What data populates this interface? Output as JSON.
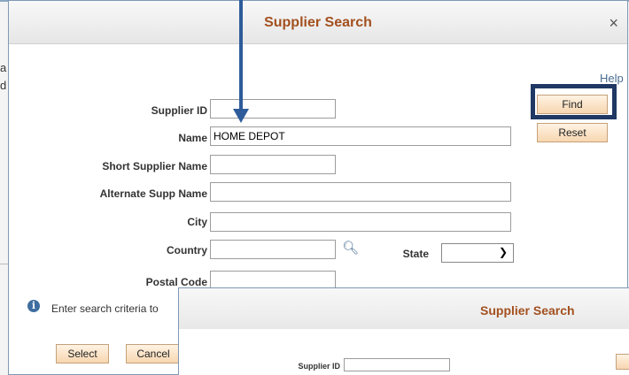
{
  "background": {
    "fragment1": "a",
    "fragment2": "d"
  },
  "dialog": {
    "title": "Supplier Search",
    "close_label": "×",
    "help_label": "Help",
    "fields": {
      "supplier_id": {
        "label": "Supplier ID",
        "value": ""
      },
      "name": {
        "label": "Name",
        "value": "HOME DEPOT"
      },
      "short_supplier_name": {
        "label": "Short Supplier Name",
        "value": ""
      },
      "alternate_supp_name": {
        "label": "Alternate Supp Name",
        "value": ""
      },
      "city": {
        "label": "City",
        "value": ""
      },
      "country": {
        "label": "Country",
        "value": ""
      },
      "state": {
        "label": "State",
        "value": ""
      },
      "postal_code": {
        "label": "Postal Code",
        "value": ""
      }
    },
    "buttons": {
      "find": "Find",
      "reset": "Reset",
      "select": "Select",
      "cancel": "Cancel"
    },
    "info_text": "Enter search criteria to"
  },
  "inset": {
    "title": "Supplier Search",
    "supplier_id_label": "Supplier ID"
  },
  "icons": {
    "lookup": "magnifier-icon",
    "info": "info-icon",
    "dropdown": "chevron-down-icon"
  },
  "colors": {
    "title": "#a3501f",
    "highlight": "#1f3864",
    "arrow": "#2e5c9a"
  }
}
